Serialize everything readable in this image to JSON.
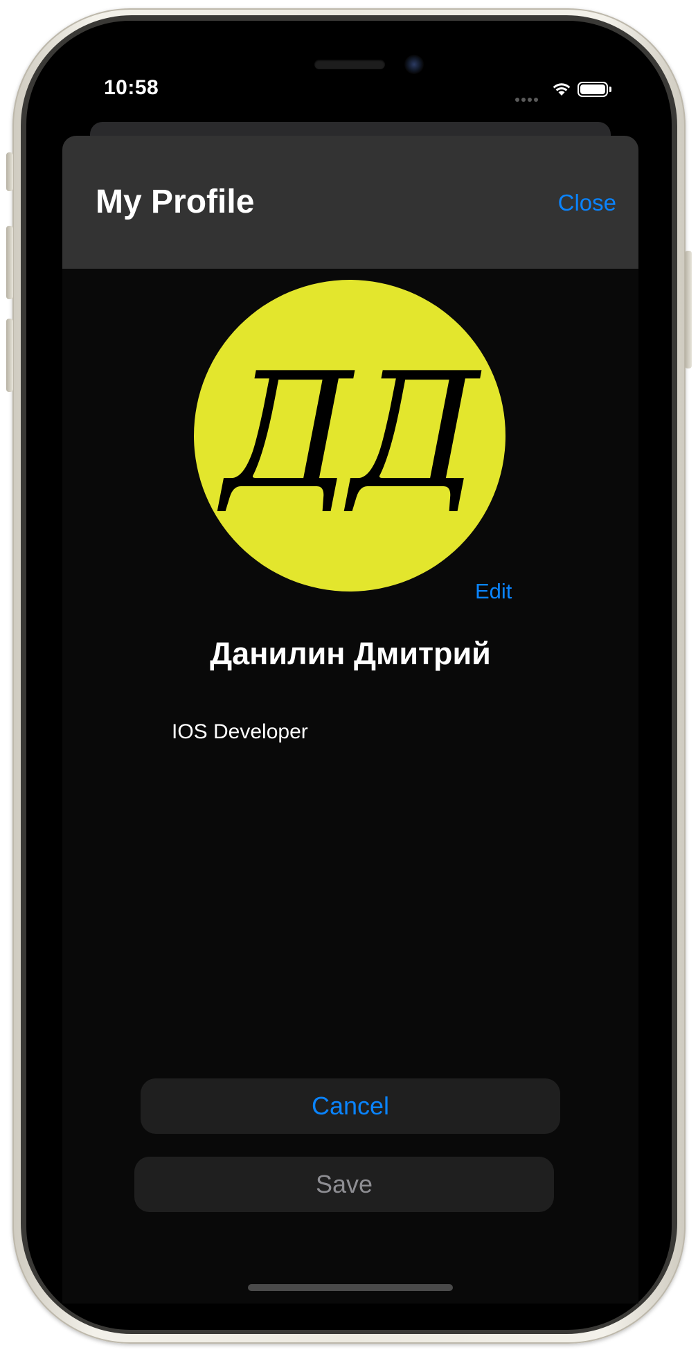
{
  "status_bar": {
    "time": "10:58"
  },
  "nav": {
    "title": "My Profile",
    "close_label": "Close"
  },
  "profile": {
    "initials": "ДД",
    "avatar_color": "#e3e62d",
    "edit_label": "Edit",
    "full_name": "Данилин Дмитрий",
    "bio": "IOS Developer"
  },
  "actions": {
    "cancel_label": "Cancel",
    "save_label": "Save"
  },
  "colors": {
    "accent": "#0a84ff",
    "navbar": "#333333",
    "background": "#090909",
    "button_bg": "#1f1f1f",
    "disabled_text": "#8e8e93"
  }
}
